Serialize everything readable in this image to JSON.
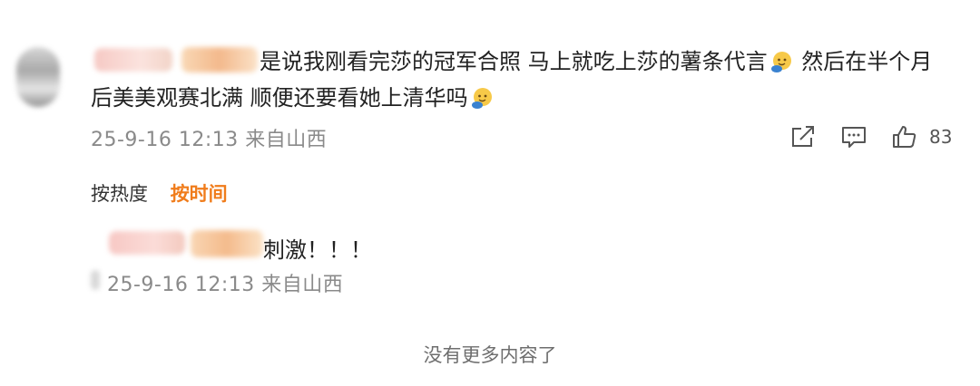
{
  "comment": {
    "text_line1": "是说我刚看完莎的冠军合照 马上就吃上莎的薯条代言",
    "text_line1_tail": " 然后在半个月",
    "text_line2": "后美美观赛北满 顺便还要看她上清华吗",
    "timestamp_location": "25-9-16 12:13 来自山西",
    "like_count": "83",
    "icons": [
      "share-icon",
      "comment-icon",
      "like-icon",
      "emoji-smile-icon"
    ]
  },
  "sort": {
    "hot_label": "按热度",
    "time_label": "按时间",
    "active_color": "#f07c1b"
  },
  "reply": {
    "text": "刺激！！！",
    "timestamp_location": "25-9-16 12:13 来自山西"
  },
  "footer": {
    "no_more": "没有更多内容了"
  }
}
